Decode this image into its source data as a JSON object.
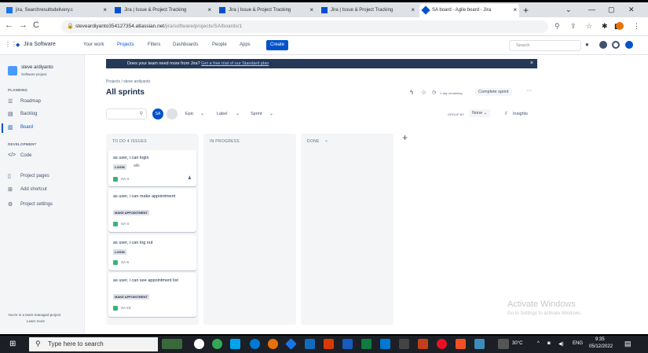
{
  "browser": {
    "tabs": [
      {
        "label": "jira, Searchresultsdelivery.c",
        "color": "#1a73e8"
      },
      {
        "label": "Jira | Issue & Project Tracking",
        "color": "#0052cc"
      },
      {
        "label": "Jira | Issue & Project Tracking",
        "color": "#0052cc"
      },
      {
        "label": "Jira | Issue & Project Tracking",
        "color": "#0052cc"
      },
      {
        "label": "SA board - Agile board - Jira",
        "color": "#0052cc"
      }
    ],
    "new_tab": "+",
    "url_host": "steveardiyanto3541273​54.atlassian.net",
    "url_path": "/jira/software/projects/SA/boards/1"
  },
  "jira_nav": {
    "product": "Jira Software",
    "items": [
      "Your work",
      "Projects",
      "Filters",
      "Dashboards",
      "People",
      "Apps"
    ],
    "create": "Create",
    "search_placeholder": "Search"
  },
  "sidebar": {
    "project_name": "steve ardiyanto",
    "project_type": "Software project",
    "planning_heading": "PLANNING",
    "planning": [
      "Roadmap",
      "Backlog",
      "Board"
    ],
    "development_heading": "DEVELOPMENT",
    "development": [
      "Code"
    ],
    "other": [
      "Project pages",
      "Add shortcut",
      "Project settings"
    ],
    "footer": "You're in a team-managed project",
    "footer_link": "Learn more"
  },
  "banner": {
    "text": "Does your team need more from Jira?",
    "link": "Get a free trial of our Standard plan"
  },
  "board": {
    "breadcrumb": "Projects / steve ardiyanto",
    "title": "All sprints",
    "days": "1 day remaining",
    "complete": "Complete sprint",
    "filters": [
      "Epic",
      "Label",
      "Sprint"
    ],
    "avatar": "SA",
    "group_by_label": "GROUP BY",
    "group_by_value": "None",
    "insights": "Insights",
    "columns": [
      {
        "title": "TO DO 4 ISSUES"
      },
      {
        "title": "IN PROGRESS"
      },
      {
        "title": "DONE"
      }
    ],
    "cards": [
      {
        "title": "as user, i can login",
        "label": "LOGIN",
        "extra": "akk",
        "key": "SA-3"
      },
      {
        "title": "as user, i can make appointment",
        "label": "MAKE APPOINTMENT",
        "extra": "",
        "key": "SA-4"
      },
      {
        "title": "as user, i can log out",
        "label": "LOGIN",
        "extra": "",
        "key": "SA-6"
      },
      {
        "title": "as user, i can see appointment list",
        "label": "MAKE APPOINTMENT",
        "extra": "",
        "key": "SA-15"
      }
    ],
    "add_column": "+"
  },
  "watermark": {
    "title": "Activate Windows",
    "sub": "Go to Settings to activate Windows."
  },
  "taskbar": {
    "search": "Type here to search",
    "temp": "30°C",
    "lang": "ENG",
    "time": "9:35",
    "date": "05/12/2022"
  }
}
